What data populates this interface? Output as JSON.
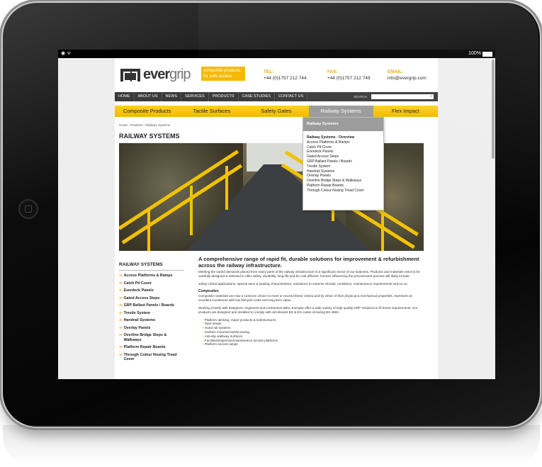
{
  "statusbar": {
    "wifi": "◉ ᯤ",
    "battery": "100%"
  },
  "logo": {
    "brand_bold": "ever",
    "brand_light": "grip"
  },
  "tagline": "composite products for safe access",
  "contact": {
    "tel_label": "TEL:",
    "tel": "+44 (0)1757 212 744",
    "fax_label": "FAX:",
    "fax": "+44 (0)1757 212 749",
    "email_label": "EMAIL:",
    "email": "info@evergrip.com"
  },
  "nav": {
    "items": [
      "HOME",
      "ABOUT US",
      "NEWS",
      "SERVICES",
      "PRODUCTS",
      "CASE STUDIES",
      "CONTACT US"
    ],
    "search_label": "SEARCH"
  },
  "subnav": {
    "items": [
      "Composite Products",
      "Tactile Surfaces",
      "Safety Gates",
      "Railway Systems",
      "Flex Impact"
    ]
  },
  "dropdown": {
    "head": "Railway Systems",
    "items": [
      "Railway Systems - Overview",
      "Access Platforms & Ramps",
      "Catch Pit Cover",
      "Everdeck Panels",
      "Gated Access Steps",
      "GRP Ballast Panels / Boards",
      "Trestle System",
      "Handrail Systems",
      "Overlay Panels",
      "Overline Bridge Steps & Walkways",
      "Platform Repair Boards",
      "Through Colour Nosing Tread Cover"
    ]
  },
  "breadcrumb": "Home › Products › Railway Systems",
  "page_title": "RAILWAY SYSTEMS",
  "sidebar": {
    "title": "RAILWAY SYSTEMS",
    "items": [
      "Access Platforms & Ramps",
      "Catch Pit Cover",
      "Everdeck Panels",
      "Gated Access Steps",
      "GRP Ballast Panels / Boards",
      "Trestle System",
      "Handrail Systems",
      "Overlay Panels",
      "Overline Bridge Steps & Walkways",
      "Platform Repair Boards",
      "Through Colour Nosing Tread Cover"
    ]
  },
  "content": {
    "heading": "A comprehensive range of rapid fit, durable solutions for improvement & refurbishment across the railway infrastructure.",
    "p1": "Meeting the varied demands placed from many parts of the railway infrastructure is a significant sector of our business. Products and materials need to be carefully designed & selected to offer safety, durability, long life and be cost efficient. Factors influencing the procurement process will likely include:",
    "p2": "safety critical applications, special wear & loading characteristics, resistance to extreme climatic conditions, maintenance requirements and so on.",
    "h2": "Composites",
    "p3": "Composite materials are now a common choice to meet or exceed these criteria and by virtue of their physical & mechanical properties, represent an excellent investment with low lifecycle costs and long term value.",
    "p4": "Working closely with designers, engineers and contractors alike, Evergrip offer a wide variety of high quality GRP solutions to fit these requirements. Our products are designed and installed to comply with all relevant BS & EN codes including BS 4592.",
    "bullets": [
      "Platform decking, repair products & substructures",
      "Stair treads",
      "Hand rail systems",
      "Surface mounted tactile paving",
      "Anti-slip walkway surfaces",
      "Facilities/inspection/maintenance access platforms",
      "Platform access ramps"
    ]
  },
  "colors": {
    "accent": "#f5b800",
    "nav": "#3a3a3a",
    "active_tab": "#9a9a9a"
  }
}
